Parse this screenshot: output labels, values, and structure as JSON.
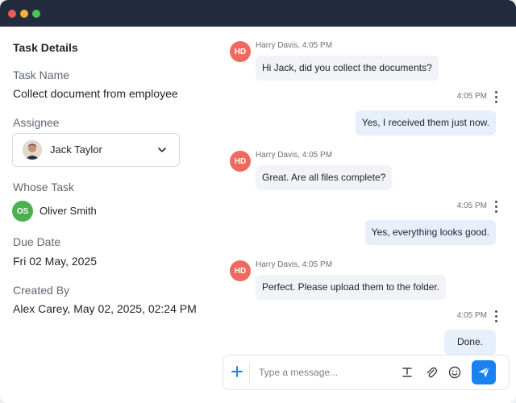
{
  "task_details": {
    "title": "Task Details",
    "task_name_label": "Task Name",
    "task_name": "Collect document from employee",
    "assignee_label": "Assignee",
    "assignee": "Jack Taylor",
    "whose_task_label": "Whose Task",
    "owner_initials": "OS",
    "owner": "Oliver Smith",
    "due_date_label": "Due Date",
    "due_date": "Fri 02 May, 2025",
    "created_by_label": "Created By",
    "created_by": "Alex Carey, May 02, 2025, 02:24 PM"
  },
  "chat": {
    "messages": [
      {
        "direction": "in",
        "initials": "HD",
        "meta": "Harry Davis, 4:05 PM",
        "text": "Hi Jack, did you collect the documents?"
      },
      {
        "direction": "out",
        "time": "4:05 PM",
        "text": "Yes, I received them just now."
      },
      {
        "direction": "in",
        "initials": "HD",
        "meta": "Harry Davis, 4:05 PM",
        "text": "Great. Are all files complete?"
      },
      {
        "direction": "out",
        "time": "4:05 PM",
        "text": "Yes, everything looks good."
      },
      {
        "direction": "in",
        "initials": "HD",
        "meta": "Harry Davis, 4:05 PM",
        "text": "Perfect. Please upload them to the folder."
      },
      {
        "direction": "out",
        "time": "4:05 PM",
        "text": "Done."
      }
    ],
    "composer": {
      "placeholder": "Type a message...",
      "icons": [
        "plus-icon",
        "text-format-icon",
        "paperclip-icon",
        "emoji-icon",
        "send-icon"
      ]
    }
  },
  "colors": {
    "titlebar": "#232b3e",
    "avatar_hd": "#ee6a5e",
    "avatar_os": "#4caf50",
    "bubble_in": "#f1f3f6",
    "bubble_out": "#e6effa",
    "send_button": "#1a82f0"
  }
}
